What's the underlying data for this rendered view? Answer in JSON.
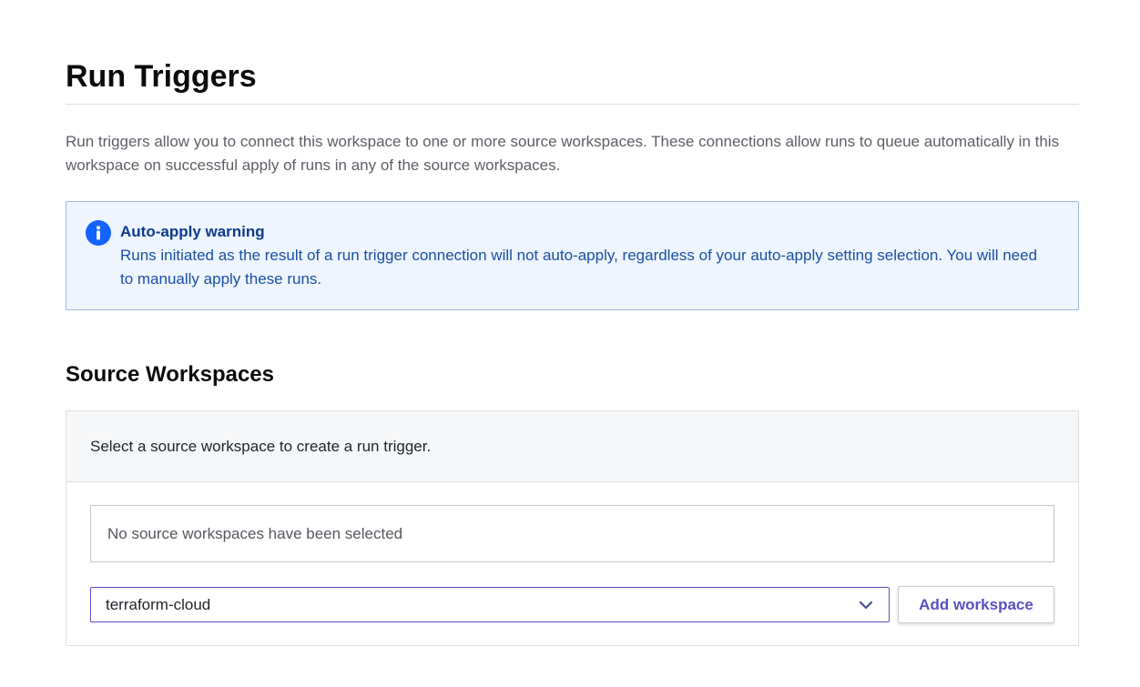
{
  "page": {
    "title": "Run Triggers",
    "intro": "Run triggers allow you to connect this workspace to one or more source workspaces. These connections allow runs to queue automatically in this workspace on successful apply of runs in any of the source workspaces."
  },
  "alert": {
    "icon": "info-icon",
    "title": "Auto-apply warning",
    "text": "Runs initiated as the result of a run trigger connection will not auto-apply, regardless of your auto-apply setting selection. You will need to manually apply these runs."
  },
  "source_workspaces": {
    "title": "Source Workspaces",
    "panel_header": "Select a source workspace to create a run trigger.",
    "empty_text": "No source workspaces have been selected",
    "select": {
      "value": "terraform-cloud",
      "icon": "chevron-down-icon"
    },
    "add_button_label": "Add workspace"
  },
  "colors": {
    "accent": "#5a4fc5",
    "info": "#1563ff",
    "alert_bg": "#eef5fe"
  }
}
